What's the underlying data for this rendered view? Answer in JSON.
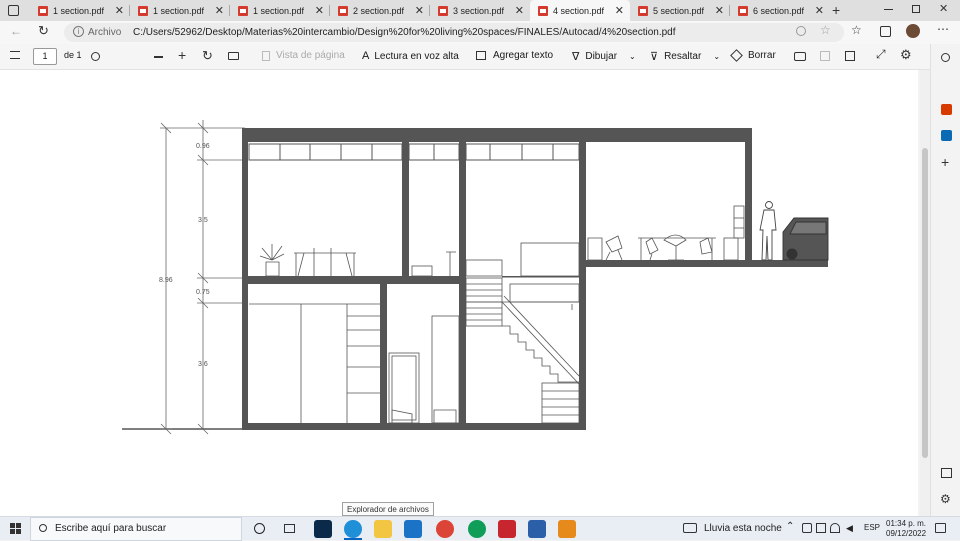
{
  "tabs": [
    {
      "label": "1 section.pdf",
      "active": false
    },
    {
      "label": "1 section.pdf",
      "active": false
    },
    {
      "label": "1 section.pdf",
      "active": false
    },
    {
      "label": "2 section.pdf",
      "active": false
    },
    {
      "label": "3 section.pdf",
      "active": false
    },
    {
      "label": "4 section.pdf",
      "active": true
    },
    {
      "label": "5 section.pdf",
      "active": false
    },
    {
      "label": "6 section.pdf",
      "active": false
    }
  ],
  "address": {
    "site_label": "Archivo",
    "url": "C:/Users/52962/Desktop/Materias%20intercambio/Design%20for%20living%20spaces/FINALES/Autocad/4%20section.pdf"
  },
  "pdf_toolbar": {
    "page_current": "1",
    "page_total": "de 1",
    "fit_page": "Vista de página",
    "read_aloud": "Lectura en voz alta",
    "add_text": "Agregar texto",
    "draw": "Dibujar",
    "highlight": "Resaltar",
    "erase": "Borrar"
  },
  "drawing": {
    "dimensions": {
      "total": "8.96",
      "roof": "0.96",
      "upper": "3.5",
      "slab": "0.75",
      "lower": "3.6"
    }
  },
  "tooltip": "Explorador de archivos",
  "taskbar": {
    "search_placeholder": "Escribe aquí para buscar",
    "weather": "Lluvia esta noche",
    "language": "ESP",
    "time": "01:34 p. m.",
    "date": "09/12/2022"
  },
  "colors": {
    "wall": "#555555",
    "pdf_icon": "#d53a2f",
    "taskbar": "#e9eef5"
  }
}
